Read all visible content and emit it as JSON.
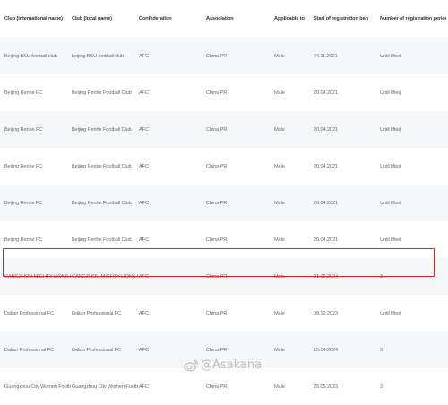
{
  "table": {
    "headers": [
      "Club (international name)",
      "Club (local name)",
      "Confederation",
      "Association",
      "Applicable to",
      "Start of registration ban",
      "Number of registration periods"
    ],
    "rows": [
      [
        "Beijing BSU football club",
        "beijing BSU football club",
        "AFC",
        "China PR",
        "Male",
        "04.11.2021",
        "Until lifted"
      ],
      [
        "Beijing Renhe FC",
        "Beijing Renhe Football Club",
        "AFC",
        "China PR",
        "Male",
        "20.04.2021",
        "Until lifted"
      ],
      [
        "Beijing Renhe FC",
        "Beijing Renhe Football Club",
        "AFC",
        "China PR",
        "Male",
        "20.04.2021",
        "Until lifted"
      ],
      [
        "Beijing Renhe FC",
        "Beijing Renhe Football Club",
        "AFC",
        "China PR",
        "Male",
        "20.04.2021",
        "Until lifted"
      ],
      [
        "Beijing Renhe FC",
        "Beijing Renhe Football Club",
        "AFC",
        "China PR",
        "Male",
        "20.04.2021",
        "Until lifted"
      ],
      [
        "Beijing Renhe FC",
        "Beijing Renhe Football Club",
        "AFC",
        "China PR",
        "Male",
        "20.04.2021",
        "Until lifted"
      ],
      [
        "CANGZHOU MIGHTY LIONS FOOTBAL...",
        "CANGZHOU MIGHTY LIONS FOOTBAL...",
        "AFC",
        "China PR",
        "Male",
        "21.06.2024",
        "3"
      ],
      [
        "Dalian Professional FC",
        "Dalian Professional FC",
        "AFC",
        "China PR",
        "Male",
        "08.12.2023",
        "Until lifted"
      ],
      [
        "Dalian Professional FC",
        "Dalian Professional FC",
        "AFC",
        "China PR",
        "Male",
        "15.04.2024",
        "3"
      ],
      [
        "Guangzhou City Women Football Club",
        "Guangzhou City Women Football Club",
        "AFC",
        "China PR",
        "Male",
        "25.05.2023",
        "3"
      ]
    ],
    "highlighted_row_index": 6
  },
  "watermark": {
    "text": "@Asakana",
    "icon": "weibo-icon",
    "color": "#8a8a8a"
  },
  "colors": {
    "highlight_border": "#e02020",
    "alt_row": "#f6f7f9"
  }
}
